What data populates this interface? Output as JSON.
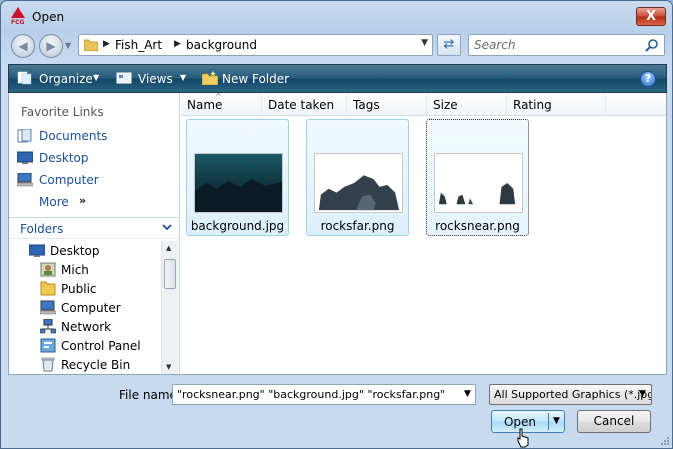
{
  "window": {
    "title": "Open",
    "close_label": "X"
  },
  "nav": {
    "back_glyph": "◀",
    "forward_glyph": "▶"
  },
  "address": {
    "crumbs": [
      "Fish_Art",
      "background"
    ]
  },
  "search": {
    "placeholder": "Search"
  },
  "toolbar": {
    "organize": "Organize",
    "views": "Views",
    "new_folder": "New Folder",
    "help": "?"
  },
  "favorites": {
    "header": "Favorite Links",
    "items": [
      {
        "label": "Documents",
        "icon": "documents-icon"
      },
      {
        "label": "Desktop",
        "icon": "desktop-icon"
      },
      {
        "label": "Computer",
        "icon": "computer-icon"
      },
      {
        "label": "More",
        "icon": "more-chevrons"
      }
    ],
    "more_glyph": "»"
  },
  "folders": {
    "label": "Folders",
    "tree": [
      {
        "label": "Desktop",
        "icon": "desktop-icon",
        "level": 0
      },
      {
        "label": "Mich",
        "icon": "user-folder-icon",
        "level": 1
      },
      {
        "label": "Public",
        "icon": "folder-icon",
        "level": 1
      },
      {
        "label": "Computer",
        "icon": "computer-icon",
        "level": 1
      },
      {
        "label": "Network",
        "icon": "network-icon",
        "level": 1
      },
      {
        "label": "Control Panel",
        "icon": "control-panel-icon",
        "level": 1
      },
      {
        "label": "Recycle Bin",
        "icon": "recycle-bin-icon",
        "level": 1
      }
    ]
  },
  "columns": [
    "Name",
    "Date taken",
    "Tags",
    "Size",
    "Rating"
  ],
  "files": [
    {
      "name": "background.jpg",
      "thumb": "dark-underwater-scene",
      "selected": true
    },
    {
      "name": "rocksfar.png",
      "thumb": "dark-rocks-on-white",
      "selected": true
    },
    {
      "name": "rocksnear.png",
      "thumb": "small-rocks-on-white",
      "selected": true,
      "focused": true
    }
  ],
  "bottom": {
    "file_name_label": "File name:",
    "file_name_value": "\"rocksnear.png\" \"background.jpg\" \"rocksfar.png\"",
    "filter_value": "All Supported Graphics (*.jpg;",
    "open_label": "Open",
    "cancel_label": "Cancel"
  },
  "colors": {
    "toolbar": "#1f5677",
    "link": "#1a4fa0",
    "selection": "#dcf0fc",
    "close": "#c94a33"
  }
}
